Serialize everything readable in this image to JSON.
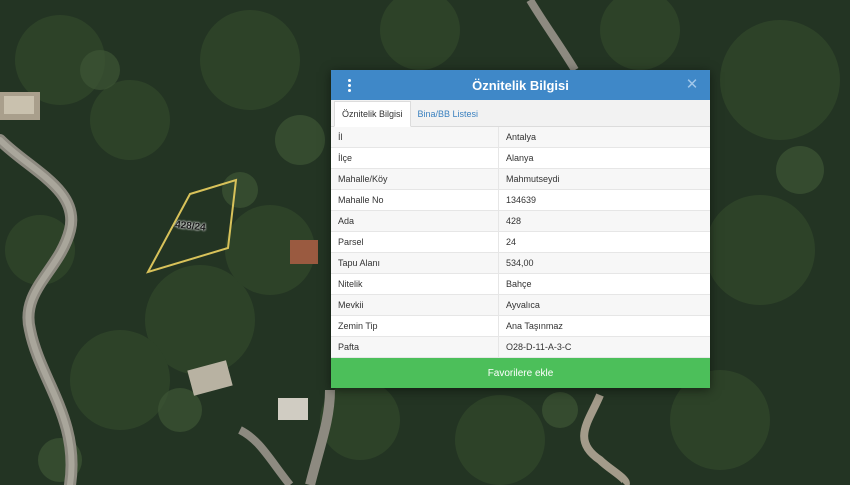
{
  "map": {
    "parcel_label": "428/24"
  },
  "dialog": {
    "title": "Öznitelik Bilgisi",
    "tabs": [
      {
        "label": "Öznitelik Bilgisi",
        "active": true
      },
      {
        "label": "Bina/BB Listesi",
        "active": false
      }
    ],
    "rows": [
      {
        "key": "İl",
        "value": "Antalya"
      },
      {
        "key": "İlçe",
        "value": "Alanya"
      },
      {
        "key": "Mahalle/Köy",
        "value": "Mahmutseydi"
      },
      {
        "key": "Mahalle No",
        "value": "134639"
      },
      {
        "key": "Ada",
        "value": "428"
      },
      {
        "key": "Parsel",
        "value": "24"
      },
      {
        "key": "Tapu Alanı",
        "value": "534,00"
      },
      {
        "key": "Nitelik",
        "value": "Bahçe"
      },
      {
        "key": "Mevkii",
        "value": "Ayvalıca"
      },
      {
        "key": "Zemin Tip",
        "value": "Ana Taşınmaz"
      },
      {
        "key": "Pafta",
        "value": "O28-D-11-A-3-C"
      }
    ],
    "favorite_button": "Favorilere ekle"
  },
  "colors": {
    "header": "#3f88c8",
    "button": "#4cbf5a",
    "parcel_outline": "#d8c25a"
  }
}
